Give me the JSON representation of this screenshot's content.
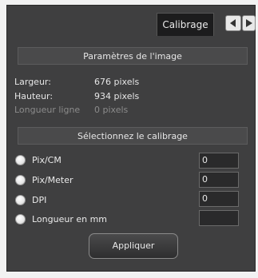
{
  "tab": {
    "label": "Calibrage"
  },
  "nav": {
    "prev_icon": "arrow-left-icon",
    "next_icon": "arrow-right-icon"
  },
  "image_params": {
    "heading": "Paramètres de l'image",
    "width_label": "Largeur:",
    "width_value": "676 pixels",
    "height_label": "Hauteur:",
    "height_value": "934 pixels",
    "line_label": "Longueur ligne",
    "line_value": "0 pixels"
  },
  "calibration": {
    "heading": "Sélectionnez le calibrage",
    "options": [
      {
        "label": "Pix/CM",
        "value": "0"
      },
      {
        "label": "Pix/Meter",
        "value": "0"
      },
      {
        "label": "DPI",
        "value": "0"
      },
      {
        "label": "Longueur en mm",
        "value": ""
      }
    ]
  },
  "apply_button": {
    "label": "Appliquer"
  }
}
